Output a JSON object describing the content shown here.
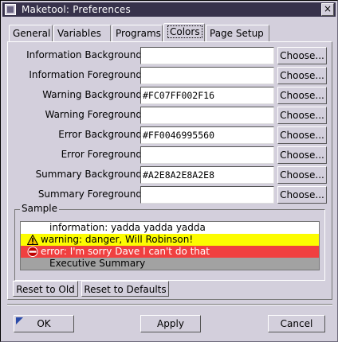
{
  "window": {
    "title": "Maketool: Preferences",
    "close_glyph": "×"
  },
  "tabs": [
    {
      "label": "General",
      "active": false
    },
    {
      "label": "Variables",
      "active": false
    },
    {
      "label": "Programs",
      "active": false
    },
    {
      "label": "Colors",
      "active": true
    },
    {
      "label": "Page Setup",
      "active": false
    }
  ],
  "colors": {
    "choose_label": "Choose...",
    "rows": [
      {
        "label": "Information Background:",
        "value": ""
      },
      {
        "label": "Information Foreground:",
        "value": ""
      },
      {
        "label": "Warning Background:",
        "value": "#FC07FF002F16"
      },
      {
        "label": "Warning Foreground:",
        "value": ""
      },
      {
        "label": "Error Background:",
        "value": "#FF0046995560"
      },
      {
        "label": "Error Foreground:",
        "value": ""
      },
      {
        "label": "Summary Background:",
        "value": "#A2E8A2E8A2E8"
      },
      {
        "label": "Summary Foreground:",
        "value": ""
      }
    ]
  },
  "sample": {
    "title": "Sample",
    "lines": {
      "info": "information: yadda yadda yadda",
      "warning": "warning: danger, Will Robinson!",
      "error": "error: I'm sorry Dave I can't do that",
      "summary": "Executive Summary"
    },
    "icons": {
      "warning": "warning-triangle-icon",
      "error": "error-no-entry-icon"
    },
    "colors": {
      "warning_bg": "#FCFC00",
      "error_bg": "#F04040",
      "summary_bg": "#A2A2A2"
    }
  },
  "reset": {
    "old_label": "Reset to Old",
    "defaults_label": "Reset to Defaults"
  },
  "footer": {
    "ok_label": "OK",
    "apply_label": "Apply",
    "cancel_label": "Cancel"
  },
  "theme": {
    "titlebar_bg": "#37324B",
    "window_bg": "#D3CFDC"
  }
}
